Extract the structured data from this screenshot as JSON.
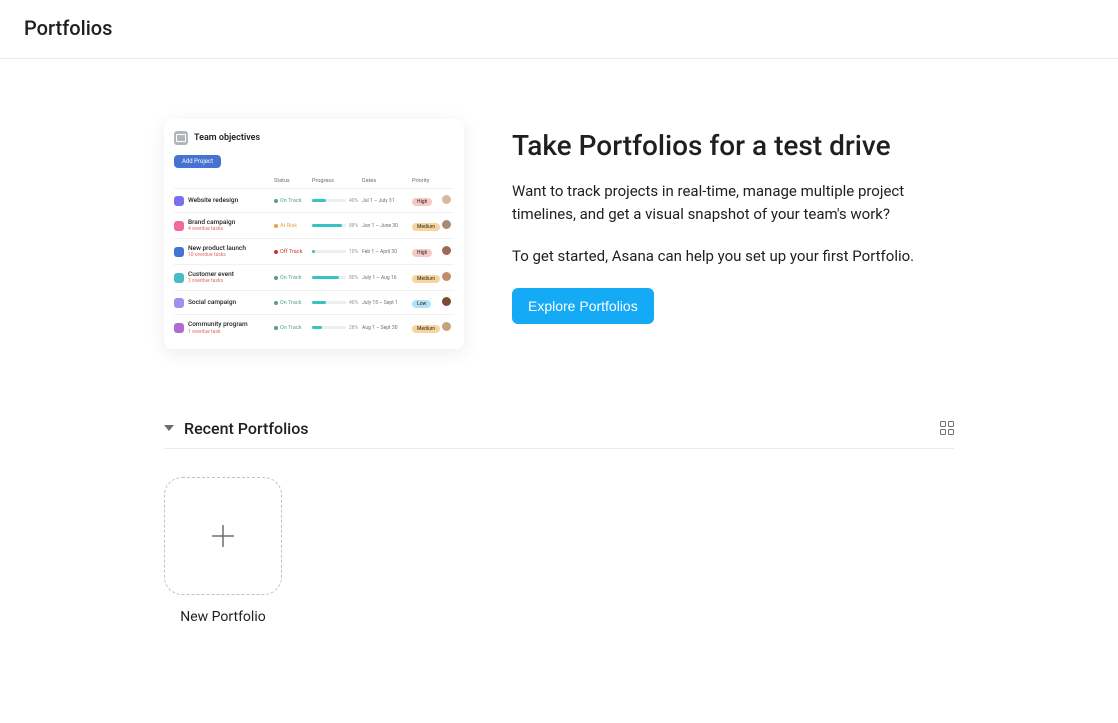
{
  "page_title": "Portfolios",
  "hero": {
    "title": "Take Portfolios for a test drive",
    "para1": "Want to track projects in real-time, manage multiple project timelines, and get a visual snapshot of your team's work?",
    "para2": "To get started, Asana can help you set up your first Portfolio.",
    "button": "Explore Portfolios"
  },
  "preview": {
    "title": "Team objectives",
    "add_button": "Add Project",
    "columns": {
      "c1": "",
      "c2": "Status",
      "c3": "Progress",
      "c4": "Dates",
      "c5": "Priority",
      "c6": ""
    },
    "rows": [
      {
        "chip": "#7a6ff0",
        "name": "Website redesign",
        "sub": "",
        "status": "On Track",
        "status_color": "#58a182",
        "bar_pct": 40,
        "bar_color": "#37c2c8",
        "pct": "40%",
        "dates": "Jul 1 – July 31",
        "prio": "High",
        "prio_bg": "#f8c8c4",
        "av": "#d9b99b"
      },
      {
        "chip": "#f06a9b",
        "name": "Brand campaign",
        "sub": "4 overdue tasks",
        "status": "At Risk",
        "status_color": "#e8a33d",
        "bar_pct": 88,
        "bar_color": "#37c2c8",
        "pct": "88%",
        "dates": "Jun 1 – June 30",
        "prio": "Medium",
        "prio_bg": "#f7d59c",
        "av": "#a78b6f"
      },
      {
        "chip": "#4573d2",
        "name": "New product launch",
        "sub": "10 overdue tasks",
        "status": "Off Track",
        "status_color": "#c9372c",
        "bar_pct": 10,
        "bar_color": "#37c2c8",
        "pct": "10%",
        "dates": "Feb 1 – April 30",
        "prio": "High",
        "prio_bg": "#f8c8c4",
        "av": "#9b6b57"
      },
      {
        "chip": "#46bdc6",
        "name": "Customer event",
        "sub": "3 overdue tasks",
        "status": "On Track",
        "status_color": "#58a182",
        "bar_pct": 80,
        "bar_color": "#37c2c8",
        "pct": "80%",
        "dates": "July 1 – Aug 16",
        "prio": "Medium",
        "prio_bg": "#f7d59c",
        "av": "#c28e6a"
      },
      {
        "chip": "#9f8fef",
        "name": "Social campaign",
        "sub": "",
        "status": "On Track",
        "status_color": "#58a182",
        "bar_pct": 40,
        "bar_color": "#37c2c8",
        "pct": "40%",
        "dates": "July 15 – Sept 1",
        "prio": "Low",
        "prio_bg": "#b3e0f7",
        "av": "#7b4b3a"
      },
      {
        "chip": "#b36bd4",
        "name": "Community program",
        "sub": "1 overdue task",
        "status": "On Track",
        "status_color": "#58a182",
        "bar_pct": 28,
        "bar_color": "#37c2c8",
        "pct": "28%",
        "dates": "Aug 1 – Sept 30",
        "prio": "Medium",
        "prio_bg": "#f7d59c",
        "av": "#caa27a"
      }
    ]
  },
  "recent": {
    "heading": "Recent Portfolios",
    "new_card_label": "New Portfolio"
  }
}
